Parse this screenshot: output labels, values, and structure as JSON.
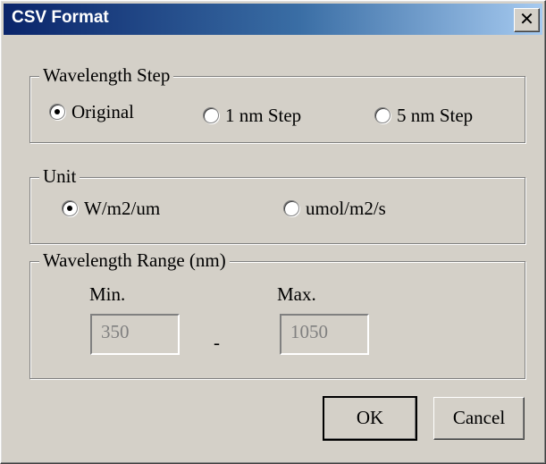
{
  "window": {
    "title": "CSV Format",
    "close_label": "✕"
  },
  "wavelength_step": {
    "legend": "Wavelength Step",
    "options": [
      {
        "label": "Original",
        "checked": true
      },
      {
        "label": "1 nm Step",
        "checked": false
      },
      {
        "label": "5 nm Step",
        "checked": false
      }
    ]
  },
  "unit": {
    "legend": "Unit",
    "options": [
      {
        "label": "W/m2/um",
        "checked": true
      },
      {
        "label": "umol/m2/s",
        "checked": false
      }
    ]
  },
  "wavelength_range": {
    "legend": "Wavelength Range (nm)",
    "min_label": "Min.",
    "max_label": "Max.",
    "min_value": "350",
    "max_value": "1050",
    "separator": "-"
  },
  "buttons": {
    "ok": "OK",
    "cancel": "Cancel"
  }
}
